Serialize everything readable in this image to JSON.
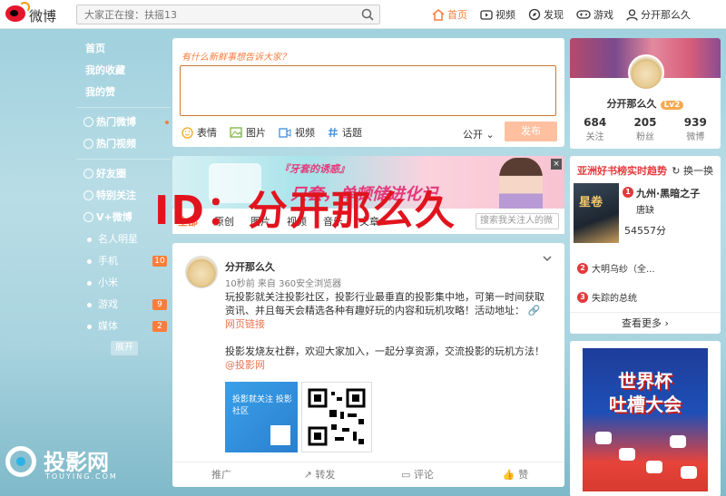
{
  "topbar": {
    "logo_text": "微博",
    "search_placeholder": "大家正在搜：扶摇13",
    "nav": [
      {
        "label": "首页",
        "icon": "home-icon",
        "active": true
      },
      {
        "label": "视频",
        "icon": "video-icon"
      },
      {
        "label": "发现",
        "icon": "compass-icon"
      },
      {
        "label": "游戏",
        "icon": "gamepad-icon"
      },
      {
        "label": "分开那么久",
        "icon": "user-icon"
      }
    ]
  },
  "sidebar": {
    "top": [
      "首页",
      "我的收藏",
      "我的赞"
    ],
    "hot": [
      "热门微博",
      "热门视频"
    ],
    "groups": [
      "好友圈",
      "特别关注",
      "V+微博"
    ],
    "subs": [
      {
        "label": "名人明星",
        "badge": ""
      },
      {
        "label": "手机",
        "badge": "10"
      },
      {
        "label": "小米",
        "badge": ""
      },
      {
        "label": "游戏",
        "badge": "9"
      },
      {
        "label": "媒体",
        "badge": "2"
      }
    ],
    "collapse_label": "展开"
  },
  "composer": {
    "prompt": "有什么新鲜事想告诉大家？",
    "tools": [
      "表情",
      "图片",
      "视频",
      "话题"
    ],
    "visibility": "公开",
    "send_label": "发布"
  },
  "banner": {
    "slogan": "『牙套的诱惑』",
    "headline": "只套，单顿储进化记"
  },
  "feed_tabs": {
    "tabs": [
      "全部",
      "原创",
      "图片",
      "视频",
      "音乐",
      "文章"
    ],
    "search_placeholder": "搜索我关注人的微"
  },
  "post": {
    "author": "分开那么久",
    "meta": "10秒前 来自 360安全浏览器",
    "text1": "玩投影就关注投影社区，投影行业最垂直的投影集中地，可第一时间获取资讯、并且每天会精选各种有趣好玩的内容和玩机攻略！活动地址：",
    "link": "网页链接",
    "text2": "投影发烧友社群，欢迎大家加入，一起分享资源，交流投影的玩机方法！",
    "mention": "@投影网",
    "image1_text": "投影就关注 投影社区",
    "actions": [
      "推广",
      "转发",
      "评论",
      "赞"
    ]
  },
  "profile": {
    "name": "分开那么久",
    "level": "Lv2",
    "stats": [
      {
        "num": "684",
        "label": "关注"
      },
      {
        "num": "205",
        "label": "粉丝"
      },
      {
        "num": "939",
        "label": "微博"
      }
    ]
  },
  "hot_books": {
    "title": "亚洲好书榜实时趋势",
    "refresh": "换一换",
    "cover_text": "星卷",
    "items": [
      {
        "rank": "1",
        "title": "九州·黑暗之子",
        "author": "唐缺",
        "score": "54557分"
      },
      {
        "rank": "2",
        "title": "大明乌纱（全..."
      },
      {
        "rank": "3",
        "title": "失踪的总统"
      }
    ],
    "more": "查看更多"
  },
  "ad": {
    "line1": "世界杯",
    "line2": "吐槽大会"
  },
  "watermark": {
    "id_text": "ID：分开那么久",
    "brand": "投影网",
    "brand_sub": "TOUYING.COM"
  },
  "colors": {
    "accent": "#fa7d3c",
    "weibo_red": "#e6162d",
    "watermark_red": "#e1141e"
  }
}
